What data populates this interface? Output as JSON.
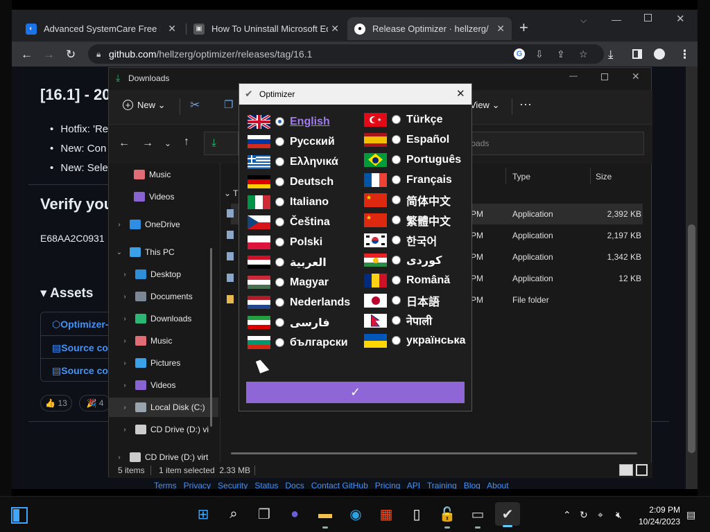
{
  "browser": {
    "tabs": [
      {
        "label": "Advanced SystemCare Free Dow",
        "icon": "iobit-icon",
        "color": "#1a73e8"
      },
      {
        "label": "How To Uninstall Microsoft Edge",
        "icon": "cube-icon",
        "color": "#888888"
      },
      {
        "label": "Release Optimizer · hellzerg/opti",
        "icon": "github-icon",
        "color": "#ffffff"
      }
    ],
    "new_tab": "+",
    "url_host": "github.com",
    "url_path": "/hellzerg/optimizer/releases/tag/16.1"
  },
  "github": {
    "heading": "[16.1] - 20",
    "bullets": [
      "Hotfix: 'Re",
      "New: Con",
      "New: Sele"
    ],
    "verify": "Verify you",
    "hash": "E68AA2C0931",
    "assets": "Assets",
    "asset_items": [
      "Optimizer-",
      "Source cod",
      "Source cod"
    ],
    "reactions": [
      {
        "emoji": "👍",
        "count": "13"
      },
      {
        "emoji": "🎉",
        "count": "4"
      }
    ],
    "footer": "Terms   Privacy   Security   Status   Docs   Contact GitHub   Pricing   API   Training   Blog   About"
  },
  "explorer": {
    "title": "Downloads",
    "toolbar": {
      "new": "New",
      "view": "View",
      "more": "···"
    },
    "search_placeholder": "nloads",
    "columns": {
      "type": "Type",
      "size": "Size"
    },
    "group": "T",
    "sidebar": [
      {
        "label": "Music",
        "icon": "music-icon",
        "color": "#e06c75",
        "indent": true
      },
      {
        "label": "Videos",
        "icon": "video-icon",
        "color": "#8a63d2",
        "indent": true
      },
      {
        "label": "OneDrive",
        "icon": "cloud-icon",
        "color": "#2e8ee6",
        "chev": "›"
      },
      {
        "label": "This PC",
        "icon": "pc-icon",
        "color": "#3aa0e8",
        "chev": "⌄"
      },
      {
        "label": "Desktop",
        "icon": "desktop-icon",
        "color": "#2f8fd6",
        "chev": "›",
        "sub": true
      },
      {
        "label": "Documents",
        "icon": "documents-icon",
        "color": "#7b8794",
        "chev": "›",
        "sub": true
      },
      {
        "label": "Downloads",
        "icon": "download-icon",
        "color": "#2bb673",
        "chev": "›",
        "sub": true
      },
      {
        "label": "Music",
        "icon": "music-icon",
        "color": "#e06c75",
        "chev": "›",
        "sub": true
      },
      {
        "label": "Pictures",
        "icon": "pictures-icon",
        "color": "#3aa0e8",
        "chev": "›",
        "sub": true
      },
      {
        "label": "Videos",
        "icon": "video-icon",
        "color": "#8a63d2",
        "chev": "›",
        "sub": true
      },
      {
        "label": "Local Disk (C:)",
        "icon": "disk-icon",
        "color": "#9aa4ad",
        "chev": "›",
        "sub": true,
        "selected": true
      },
      {
        "label": "CD Drive (D:) vi",
        "icon": "cd-icon",
        "color": "#cccccc",
        "chev": "›",
        "sub": true
      },
      {
        "label": "CD Drive (D:) virt",
        "icon": "cd-icon",
        "color": "#cccccc",
        "chev": "›"
      }
    ],
    "rows": [
      {
        "time": "PM",
        "type": "Application",
        "size": "2,392 KB",
        "selected": true
      },
      {
        "time": "PM",
        "type": "Application",
        "size": "2,197 KB"
      },
      {
        "time": "PM",
        "type": "Application",
        "size": "1,342 KB"
      },
      {
        "time": "PM",
        "type": "Application",
        "size": "12 KB"
      },
      {
        "time": "PM",
        "type": "File folder",
        "size": ""
      }
    ],
    "status": {
      "items": "5 items",
      "selected": "1 item selected  2.33 MB"
    }
  },
  "optimizer": {
    "title": "Optimizer",
    "confirm": "✓",
    "languages": [
      {
        "label": "English",
        "flag": "uk",
        "selected": true
      },
      {
        "label": "Русский",
        "flag": "ru"
      },
      {
        "label": "Ελληνικά",
        "flag": "gr"
      },
      {
        "label": "Deutsch",
        "flag": "de"
      },
      {
        "label": "Italiano",
        "flag": "it"
      },
      {
        "label": "Čeština",
        "flag": "cz"
      },
      {
        "label": "Polski",
        "flag": "pl"
      },
      {
        "label": "العربية",
        "flag": "eg"
      },
      {
        "label": "Magyar",
        "flag": "hu"
      },
      {
        "label": "Nederlands",
        "flag": "nl"
      },
      {
        "label": "فارسی",
        "flag": "ir"
      },
      {
        "label": "български",
        "flag": "bg"
      },
      {
        "label": "Türkçe",
        "flag": "tr"
      },
      {
        "label": "Español",
        "flag": "es"
      },
      {
        "label": "Português",
        "flag": "br"
      },
      {
        "label": "Français",
        "flag": "fr"
      },
      {
        "label": "简体中文",
        "flag": "cn"
      },
      {
        "label": "繁體中文",
        "flag": "cn"
      },
      {
        "label": "한국어",
        "flag": "kr"
      },
      {
        "label": "كوردی",
        "flag": "ku"
      },
      {
        "label": "Română",
        "flag": "ro"
      },
      {
        "label": "日本語",
        "flag": "jp"
      },
      {
        "label": "नेपाली",
        "flag": "np"
      },
      {
        "label": "українська",
        "flag": "ua"
      }
    ]
  },
  "taskbar": {
    "time": "2:09 PM",
    "date": "10/24/2023",
    "apps": [
      {
        "name": "start-icon",
        "glyph": "⊞",
        "color": "#3ea6ff"
      },
      {
        "name": "search-icon",
        "glyph": "⌕",
        "color": "#ffffff"
      },
      {
        "name": "task-view-icon",
        "glyph": "❐",
        "color": "#cccccc"
      },
      {
        "name": "chat-icon",
        "glyph": "●",
        "color": "#6b5fd6"
      },
      {
        "name": "file-explorer-icon",
        "glyph": "▬",
        "color": "#f2c14e"
      },
      {
        "name": "edge-icon",
        "glyph": "◉",
        "color": "#2ba3e0"
      },
      {
        "name": "store-icon",
        "glyph": "▦",
        "color": "#f25022"
      },
      {
        "name": "notepad-icon",
        "glyph": "▯",
        "color": "#ffffff"
      },
      {
        "name": "lock-app-icon",
        "glyph": "🔓",
        "color": "#e0a030"
      },
      {
        "name": "terminal-icon",
        "glyph": "▭",
        "color": "#cccccc"
      },
      {
        "name": "optimizer-app-icon",
        "glyph": "✔",
        "color": "#dddddd"
      }
    ]
  }
}
